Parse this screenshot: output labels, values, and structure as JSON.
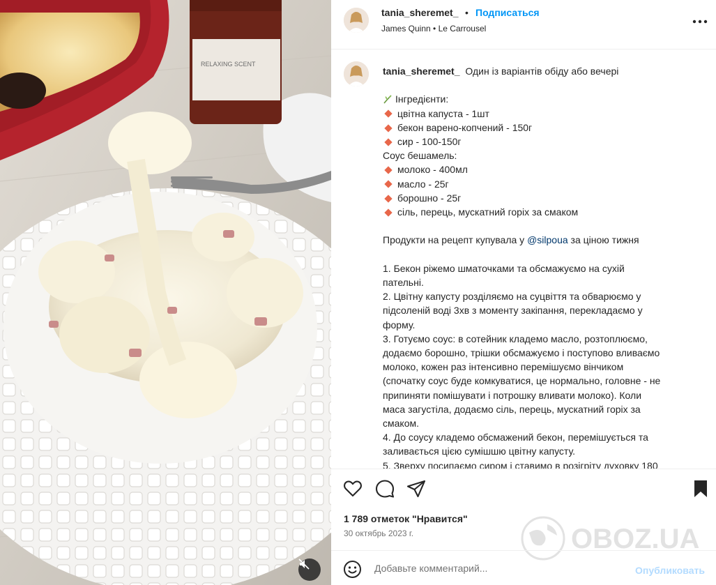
{
  "photo": {
    "jar_label": "RELAXING SCENT"
  },
  "header": {
    "username": "tania_sheremet_",
    "separator": "•",
    "follow_label": "Подписаться",
    "audio_artist": "James Quinn",
    "audio_title": "Le Carrousel"
  },
  "caption": {
    "username": "tania_sheremet_",
    "intro": "Один із варіантів обіду або вечері",
    "ingredients_title": "Інгредієнти:",
    "ingredients": [
      "цвітна капуста - 1шт",
      "бекон варено-копчений - 150г",
      "сир - 100-150г"
    ],
    "sauce_title": "Соус бешамель:",
    "sauce_items": [
      "молоко - 400мл",
      "масло - 25г",
      "борошно - 25г",
      "сіль, перець, мускатний горіх за смаком"
    ],
    "shop_prefix": "Продукти на рецепт купувала у ",
    "shop_mention": "@silpoua",
    "shop_suffix": " за ціною тижня",
    "steps": [
      "1. Бекон ріжемо шматочками та обсмажуємо на сухій",
      "пательні.",
      "2. Цвітну капусту розділяємо на суцвіття та обварюємо у",
      "підсоленій воді 3хв з моменту закіпання, перекладаємо у",
      "форму.",
      "3. Готуємо соус: в сотейник кладемо масло, розтоплюємо,",
      "додаємо борошно, трішки обсмажуємо і поступово вливаємо",
      "молоко, кожен раз інтенсивно перемішуємо вінчиком",
      "(спочатку соус буде комкуватися, це нормально, головне - не",
      "припиняти помішувати і потрошку вливати молоко). Коли",
      "маса загустіла, додаємо сіль, перець, мускатний горіх за",
      "смаком.",
      "4. До соусу кладемо обсмажений бекон, перемішується та",
      "заливається цією сумішшю цвітну капусту.",
      "5. Зверху посипаємо сиром і ставимо в розігріту духовку 180"
    ]
  },
  "stats": {
    "likes": "1 789 отметок \"Нравится\"",
    "date": "30 октябрь 2023 г."
  },
  "comment": {
    "placeholder": "Добавьте комментарий...",
    "publish_label": "Опубликовать"
  },
  "watermark": {
    "text": "OBOZ.UA"
  },
  "colors": {
    "accent_blue": "#0095f6",
    "publish_disabled": "#b3dbff",
    "bullet": "#e8674a",
    "dish_red": "#b5232d"
  },
  "icons": [
    "more-options-icon",
    "heart-icon",
    "comment-icon",
    "share-icon",
    "bookmark-icon",
    "emoji-icon",
    "mute-icon",
    "sprout-icon"
  ]
}
